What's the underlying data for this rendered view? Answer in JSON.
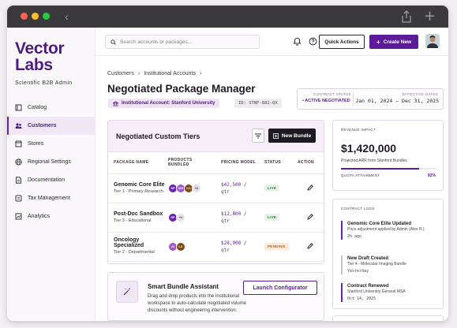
{
  "window": {
    "colors": {
      "close": "#ff5f57",
      "minimize": "#febc2e",
      "maximize": "#28c840"
    }
  },
  "brand": {
    "name": "Vector Labs",
    "line1": "Vector",
    "line2": "Labs",
    "subtitle": "Scientific B2B Admin",
    "color": "#4d1d7c"
  },
  "sidebar": {
    "items": [
      {
        "label": "Catalog",
        "icon": "book-icon",
        "active": false
      },
      {
        "label": "Customers",
        "icon": "users-icon",
        "active": true
      },
      {
        "label": "Stores",
        "icon": "store-icon",
        "active": false
      },
      {
        "label": "Regional Settings",
        "icon": "globe-icon",
        "active": false
      },
      {
        "label": "Documentation",
        "icon": "document-icon",
        "active": false
      },
      {
        "label": "Tax Management",
        "icon": "receipt-icon",
        "active": false
      },
      {
        "label": "Analytics",
        "icon": "chart-icon",
        "active": false
      }
    ]
  },
  "topbar": {
    "search_placeholder": "Search accounts or packages...",
    "quick_actions": "Quick Actions",
    "create_new": "Create New",
    "accent": "#5b1c9a"
  },
  "breadcrumb": [
    "Customers",
    "Institutional Accounts"
  ],
  "page": {
    "title": "Negotiated Package Manager",
    "account_badge": "Institutional Account: Stanford University",
    "id_badge": "ID: STNF-882-QX"
  },
  "contract": {
    "status_label": "CONTRACT STATUS",
    "status": "• ACTIVE NEGOTIATED",
    "dates_label": "EFFECTIVE DATES",
    "dates": "Jan 01, 2024 – Dec 31, 2025"
  },
  "tiers": {
    "title": "Negotiated Custom Tiers",
    "new_bundle": "New Bundle",
    "columns": [
      "PACKAGE NAME",
      "PRODUCTS BUNDLED",
      "PRICING MODEL",
      "STATUS",
      "ACTION"
    ],
    "rows": [
      {
        "name": "Genomic Core Elite",
        "sub": "Tier 1 - Primary Research",
        "chips": [
          "SP",
          "MS",
          "LC"
        ],
        "more": "+2",
        "price": "$42,500 /",
        "unit": "qtr",
        "status": "LIVE"
      },
      {
        "name": "Post-Doc Sandbox",
        "sub": "Tier 3 - Educational",
        "chips": [
          "SP"
        ],
        "more": "+1",
        "price": "$12,800 /",
        "unit": "qtr",
        "status": "LIVE"
      },
      {
        "name": "Oncology Specialized",
        "sub": "Tier 2 - Departmental",
        "chips": [
          "AI",
          "LC"
        ],
        "more": "",
        "price": "$28,900 /",
        "unit": "qtr",
        "status": "PENDING"
      }
    ]
  },
  "assistant": {
    "title": "Smart Bundle Assistant",
    "description": "Drag and drop products into the institutional workspace to auto-calculate negotiated volume discounts without engineering intervention.",
    "button": "Launch Configurator"
  },
  "revenue": {
    "label": "REVENUE IMPACT",
    "value": "$1,420,000",
    "sub": "Projected ARR from Stanford Bundles",
    "quota_label": "QUOTA ATTAINMENT",
    "quota_value": "82%",
    "quota_fraction": 0.82
  },
  "logs": {
    "label": "CONTRACT LOGS",
    "entries": [
      {
        "title": "Genomic Core Elite Updated",
        "desc": "Price adjustment applied by Admin (Alex R.)",
        "time": "2h ago"
      },
      {
        "title": "New Draft Created",
        "desc": "Tier 4 - Molecular Imaging Bundle",
        "time": "Yesterday"
      },
      {
        "title": "Contract Renewed",
        "desc": "Stanford University General MSA",
        "time": "Oct 14, 2025"
      }
    ]
  }
}
